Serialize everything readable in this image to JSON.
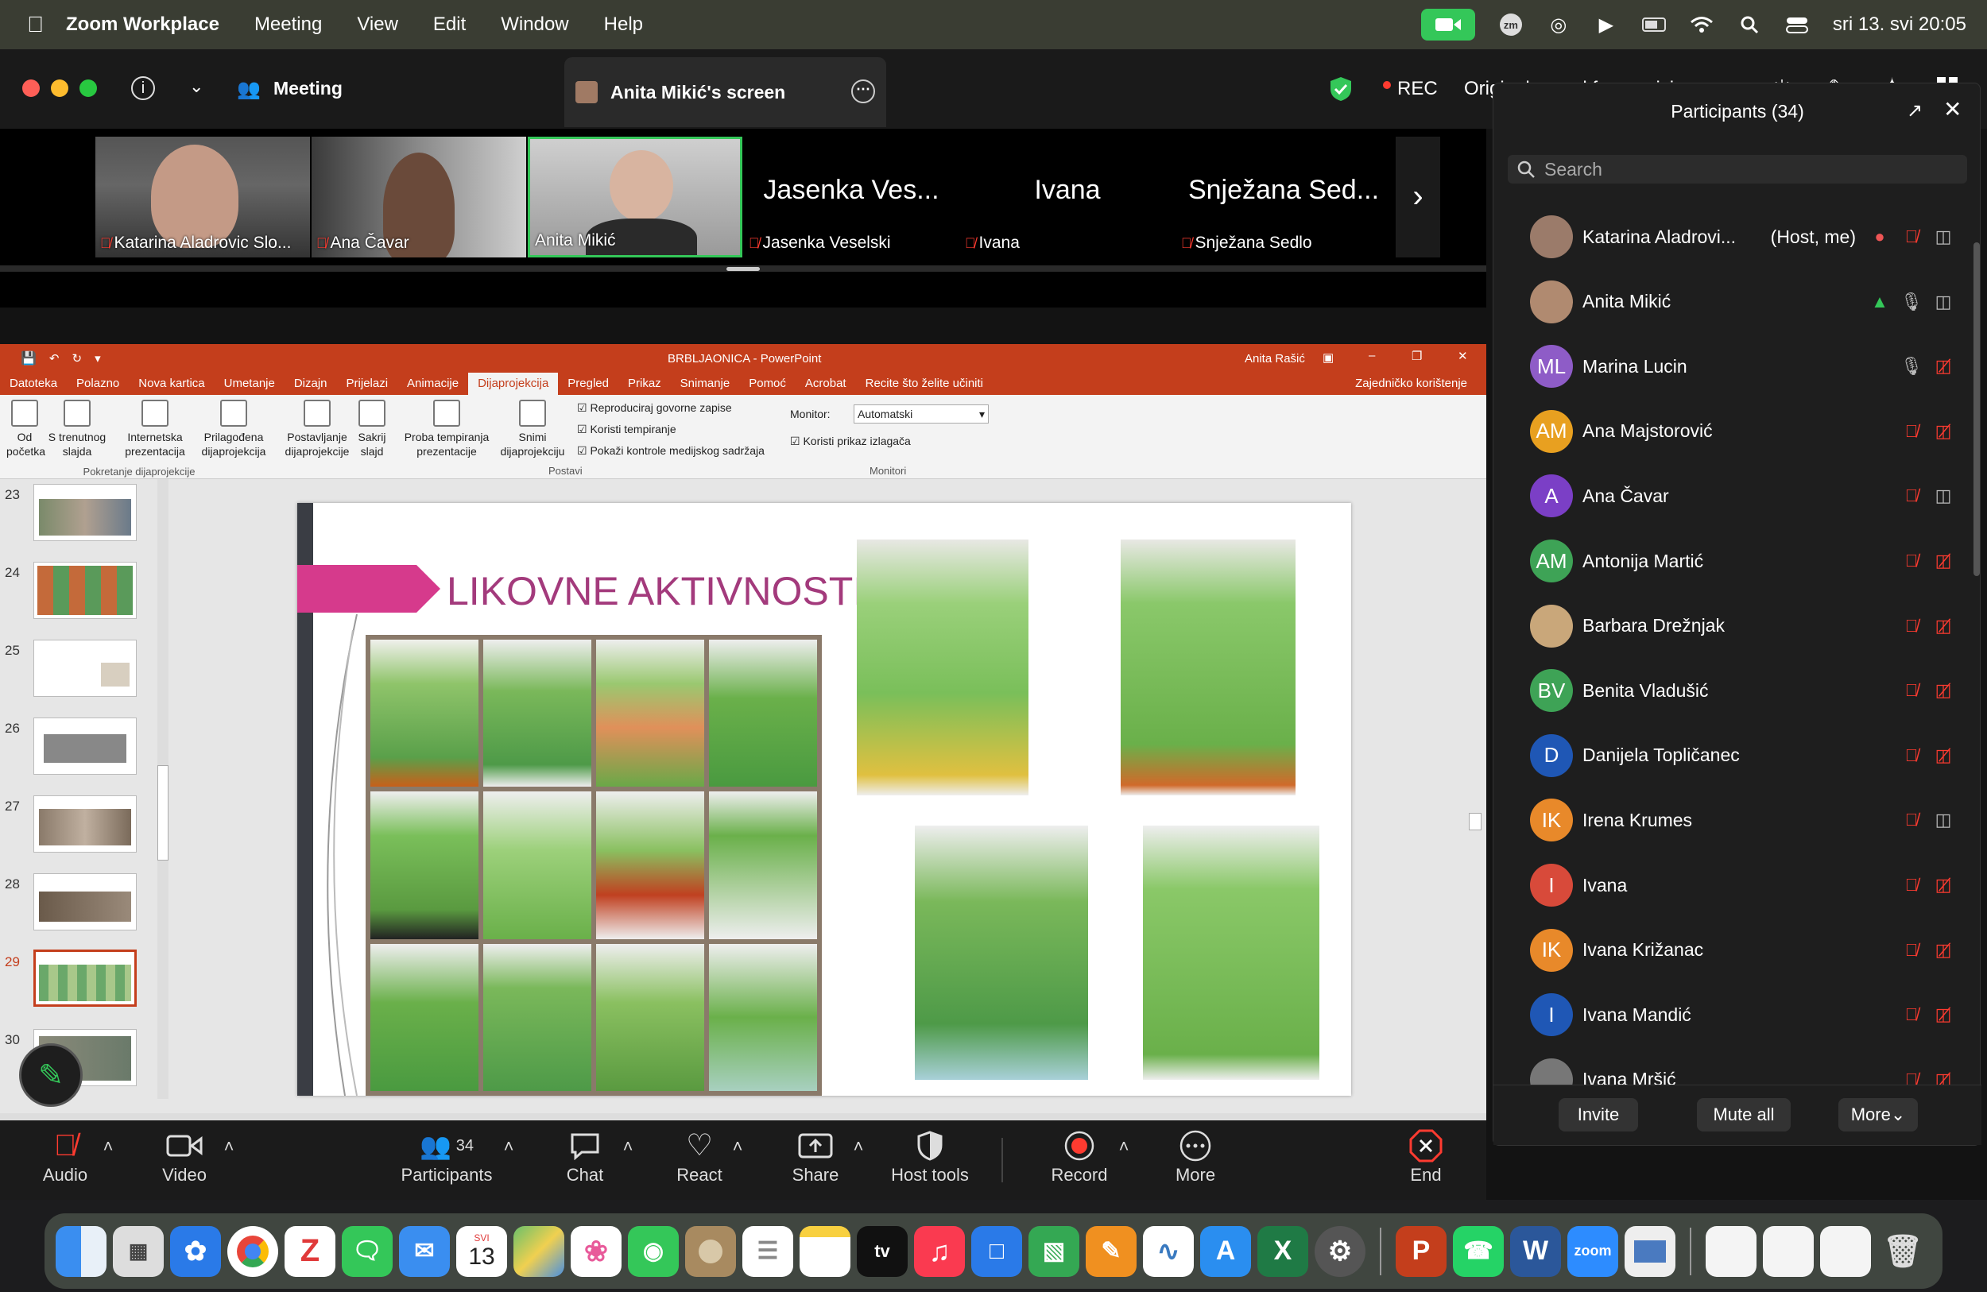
{
  "menubar": {
    "app": "Zoom Workplace",
    "items": [
      "Meeting",
      "View",
      "Edit",
      "Window",
      "Help"
    ],
    "datetime": "sri 13. svi 20:05"
  },
  "zoom": {
    "title": "Meeting",
    "share_tab": "Anita Mikić's screen",
    "rec": "REC",
    "sound": "Original sound for musicians: on",
    "strip": [
      {
        "name": "Katarina Aladrovic Slo...",
        "video": true
      },
      {
        "name": "Ana Čavar",
        "video": true
      },
      {
        "name": "Anita Mikić",
        "video": true,
        "active": true
      },
      {
        "name": "Jasenka Veselski",
        "big": "Jasenka Ves..."
      },
      {
        "name": "Ivana",
        "big": "Ivana"
      },
      {
        "name": "Snježana Sedlo",
        "big": "Snježana Sed..."
      }
    ]
  },
  "ppt": {
    "title": "BRBLJAONICA - PowerPoint",
    "user": "Anita Rašić",
    "tabs": [
      "Datoteka",
      "Polazno",
      "Nova kartica",
      "Umetanje",
      "Dizajn",
      "Prijelazi",
      "Animacije",
      "Dijaprojekcija",
      "Pregled",
      "Prikaz",
      "Snimanje",
      "Pomoć",
      "Acrobat"
    ],
    "tellme": "Recite što želite učiniti",
    "share": "Zajedničko korištenje",
    "ribbon": {
      "b1": "Od početka",
      "b2": "S trenutnog slajda",
      "b3": "Internetska prezentacija",
      "b4": "Prilagođena dijaprojekcija",
      "g1": "Pokretanje dijaprojekcije",
      "b5": "Postavljanje dijaprojekcije",
      "b6": "Sakrij slajd",
      "b7": "Proba tempiranja prezentacije",
      "b8": "Snimi dijaprojekciju",
      "c1": "Reproduciraj govorne zapise",
      "c2": "Koristi tempiranje",
      "c3": "Pokaži kontrole medijskog sadržaja",
      "g2": "Postavi",
      "monitor_label": "Monitor:",
      "monitor_value": "Automatski",
      "c4": "Koristi prikaz izlagača",
      "g3": "Monitori"
    },
    "thumb_nums": [
      "23",
      "24",
      "25",
      "26",
      "27",
      "28",
      "29",
      "30"
    ],
    "slide_title": "LIKOVNE AKTIVNOSTI"
  },
  "participants": {
    "title": "Participants (34)",
    "search_placeholder": "Search",
    "list": [
      {
        "name": "Katarina Aladrovi...",
        "suffix": "(Host, me)",
        "initials": "",
        "color": "#9b7b6a",
        "photo": true,
        "mic": "off",
        "cam": "on"
      },
      {
        "name": "Anita Mikić",
        "initials": "",
        "color": "#b08a70",
        "photo": true,
        "mic": "on",
        "cam": "on",
        "sharing": true
      },
      {
        "name": "Marina Lucin",
        "initials": "ML",
        "color": "#8e5cc7",
        "mic": "on",
        "cam": "off"
      },
      {
        "name": "Ana Majstorović",
        "initials": "AM",
        "color": "#e8a020",
        "mic": "off",
        "cam": "off"
      },
      {
        "name": "Ana Čavar",
        "initials": "A",
        "color": "#7b3fc6",
        "mic": "off",
        "cam": "on"
      },
      {
        "name": "Antonija Martić",
        "initials": "AM",
        "color": "#3ea356",
        "mic": "off",
        "cam": "off"
      },
      {
        "name": "Barbara Drežnjak",
        "initials": "",
        "color": "#c9a77a",
        "photo": true,
        "mic": "off",
        "cam": "off"
      },
      {
        "name": "Benita Vladušić",
        "initials": "BV",
        "color": "#3ea356",
        "mic": "off",
        "cam": "off"
      },
      {
        "name": "Danijela Topličanec",
        "initials": "D",
        "color": "#1f57b5",
        "mic": "off",
        "cam": "off"
      },
      {
        "name": "Irena Krumes",
        "initials": "IK",
        "color": "#e8892a",
        "mic": "off",
        "cam": "on"
      },
      {
        "name": "Ivana",
        "initials": "I",
        "color": "#d84a3a",
        "mic": "off",
        "cam": "off"
      },
      {
        "name": "Ivana Križanac",
        "initials": "IK",
        "color": "#e8892a",
        "mic": "off",
        "cam": "off"
      },
      {
        "name": "Ivana Mandić",
        "initials": "I",
        "color": "#1f57b5",
        "mic": "off",
        "cam": "off"
      },
      {
        "name": "Ivana Mršić",
        "initials": "",
        "color": "#777",
        "photo": true,
        "mic": "off",
        "cam": "off"
      }
    ],
    "invite": "Invite",
    "mute_all": "Mute all",
    "more": "More"
  },
  "toolbar": {
    "audio": "Audio",
    "video": "Video",
    "participants": "Participants",
    "participants_count": "34",
    "chat": "Chat",
    "react": "React",
    "share": "Share",
    "host_tools": "Host tools",
    "record": "Record",
    "more": "More",
    "end": "End"
  },
  "dock": {
    "calendar_month": "SVI",
    "calendar_day": "13",
    "tv": "tv",
    "zoom": "zoom"
  }
}
